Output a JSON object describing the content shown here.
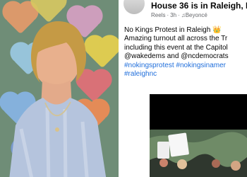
{
  "post": {
    "author_line": "House 36 is in Raleigh, NC",
    "meta": {
      "type": "Reels",
      "time": "3h",
      "music": "♫Beyoncé"
    },
    "text_lines": [
      "No Kings Protest in Raleigh 👑",
      "Amazing turnout all across the Tr",
      "including this event at the Capitol"
    ],
    "mentions_line": "@wakedems and @ncdemocrats",
    "hashtags": [
      "#nokingsprotest #nokingsinamer",
      "#raleighnc"
    ]
  },
  "colors": {
    "link": "#216fdb",
    "text": "#050505",
    "meta": "#65676b"
  }
}
